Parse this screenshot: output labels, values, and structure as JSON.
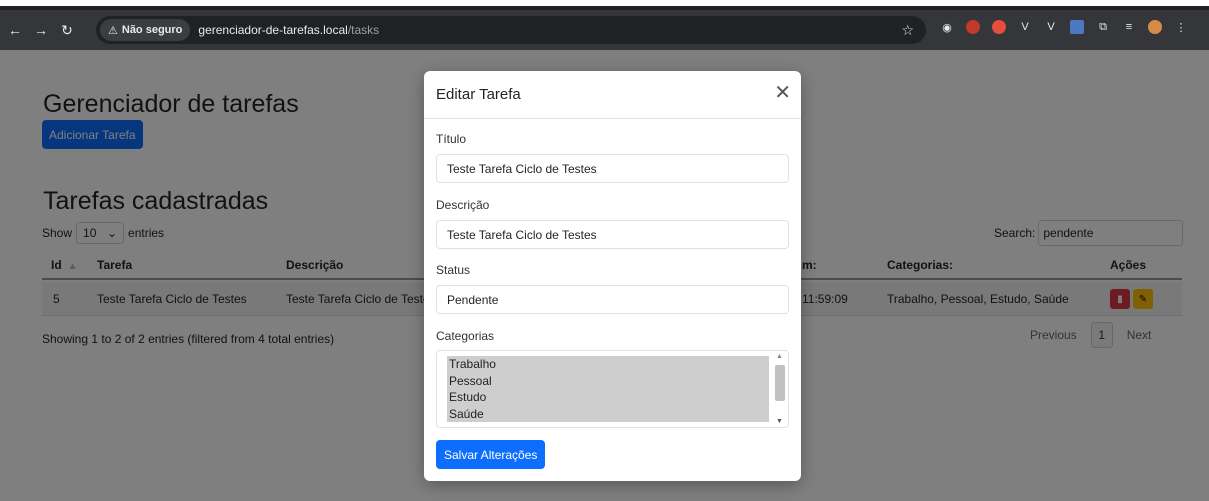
{
  "browser": {
    "security_label": "Não seguro",
    "url_host": "gerenciador-de-tarefas.local",
    "url_path": "/tasks"
  },
  "page": {
    "title": "Gerenciador de tarefas",
    "add_button": "Adicionar Tarefa",
    "list_title": "Tarefas cadastradas",
    "show_label": "Show",
    "entries_value": "10",
    "entries_label": "entries",
    "search_label": "Search:",
    "search_value": "pendente",
    "columns": [
      "Id",
      "Tarefa",
      "Descrição",
      "m:",
      "Categorias:",
      "Ações"
    ],
    "row": {
      "id": "5",
      "tarefa": "Teste Tarefa Ciclo de Testes",
      "descricao": "Teste Tarefa Ciclo de Teste",
      "fim": "11:59:09",
      "categorias": "Trabalho, Pessoal, Estudo, Saúde"
    },
    "info": "Showing 1 to 2 of 2 entries (filtered from 4 total entries)",
    "pager": {
      "previous": "Previous",
      "page": "1",
      "next": "Next"
    }
  },
  "modal": {
    "title": "Editar Tarefa",
    "titulo_label": "Título",
    "titulo_value": "Teste Tarefa Ciclo de Testes",
    "descricao_label": "Descrição",
    "descricao_value": "Teste Tarefa Ciclo de Testes",
    "status_label": "Status",
    "status_value": "Pendente",
    "categorias_label": "Categorias",
    "categorias_options": [
      "Trabalho",
      "Pessoal",
      "Estudo",
      "Saúde"
    ],
    "save_button": "Salvar Alterações"
  }
}
